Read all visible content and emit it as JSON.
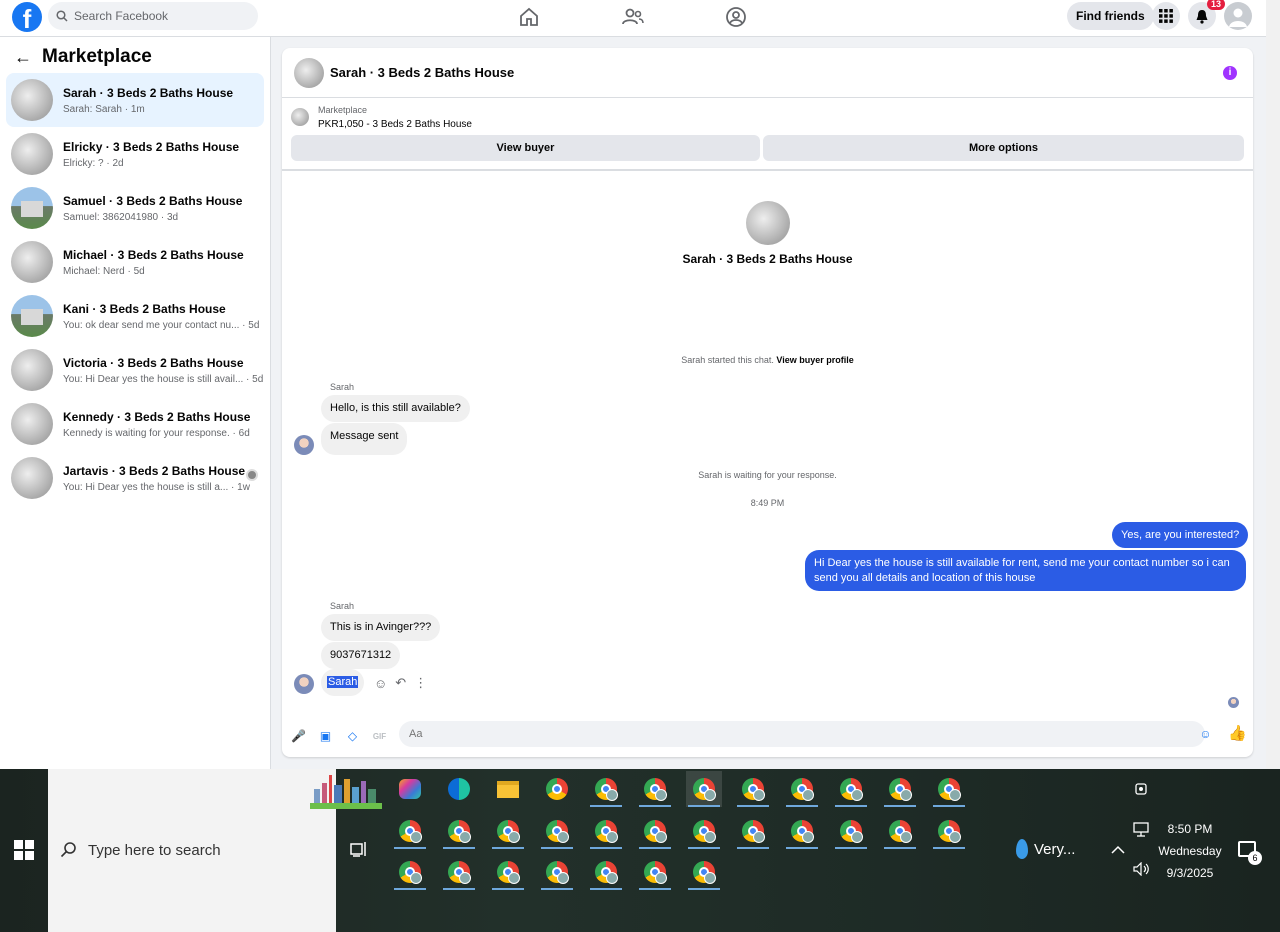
{
  "header": {
    "search_placeholder": "Search Facebook",
    "find_friends": "Find friends",
    "notif_count": "13"
  },
  "sidebar": {
    "title": "Marketplace",
    "items": [
      {
        "title": "Sarah · 3 Beds 2 Baths House",
        "sub": "Sarah: Sarah · 1m",
        "active": true
      },
      {
        "title": "Elricky · 3 Beds 2 Baths House",
        "sub": "Elricky: ? · 2d"
      },
      {
        "title": "Samuel · 3 Beds 2 Baths House",
        "sub": "Samuel: 3862041980 · 3d"
      },
      {
        "title": "Michael · 3 Beds 2 Baths House",
        "sub": "Michael: Nerd · 5d"
      },
      {
        "title": "Kani · 3 Beds 2 Baths House",
        "sub": "You: ok dear send me your contact nu... · 5d"
      },
      {
        "title": "Victoria · 3 Beds 2 Baths House",
        "sub": "You: Hi Dear yes the house is still avail... · 5d"
      },
      {
        "title": "Kennedy · 3 Beds 2 Baths House",
        "sub": "Kennedy is waiting for your response. · 6d"
      },
      {
        "title": "Jartavis · 3 Beds 2 Baths House",
        "sub": "You: Hi Dear yes the house is still a... · 1w"
      }
    ]
  },
  "chat": {
    "title": "Sarah · 3 Beds 2 Baths House",
    "listing_label": "Marketplace",
    "listing_price": "PKR1,050 - 3 Beds 2 Baths House",
    "view_buyer": "View buyer",
    "more_options": "More options",
    "center_name": "Sarah · 3 Beds 2 Baths House",
    "started_text": "Sarah started this chat.",
    "view_profile": "View buyer profile",
    "sender1": "Sarah",
    "msg1": "Hello, is this still available?",
    "msg2": "Message sent",
    "waiting": "Sarah is waiting for your response.",
    "time": "8:49 PM",
    "out1": "Yes, are you interested?",
    "out2": "Hi Dear yes the house is still available for rent, send me your contact number so i can send you all details and location of this house",
    "sender2": "Sarah",
    "msg3": "This is in Avinger???",
    "msg4": "9037671312",
    "msg5": "Sarah",
    "input_placeholder": "Aa"
  },
  "taskbar": {
    "search_placeholder": "Type here to search",
    "weather": "Very...",
    "time": "8:50 PM",
    "day": "Wednesday",
    "date": "9/3/2025",
    "notif_count": "6"
  }
}
